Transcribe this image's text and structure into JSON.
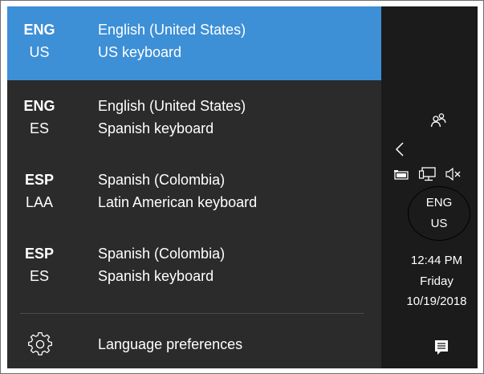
{
  "languages": [
    {
      "code": "ENG",
      "sub": "US",
      "language": "English (United States)",
      "keyboard": "US keyboard",
      "selected": true
    },
    {
      "code": "ENG",
      "sub": "ES",
      "language": "English (United States)",
      "keyboard": "Spanish keyboard",
      "selected": false
    },
    {
      "code": "ESP",
      "sub": "LAA",
      "language": "Spanish (Colombia)",
      "keyboard": "Latin American keyboard",
      "selected": false
    },
    {
      "code": "ESP",
      "sub": "ES",
      "language": "Spanish (Colombia)",
      "keyboard": "Spanish keyboard",
      "selected": false
    }
  ],
  "preferences_label": "Language preferences",
  "taskbar": {
    "input_indicator": {
      "code": "ENG",
      "sub": "US"
    },
    "time": "12:44 PM",
    "day": "Friday",
    "date": "10/19/2018"
  },
  "colors": {
    "selected": "#3d8fd6",
    "flyout_bg": "#2b2b2b",
    "taskbar_bg": "#1b1b1b"
  },
  "icons": [
    "gear-icon",
    "people-icon",
    "chevron-left-icon",
    "battery-icon",
    "network-icon",
    "volume-muted-icon",
    "action-center-icon"
  ]
}
